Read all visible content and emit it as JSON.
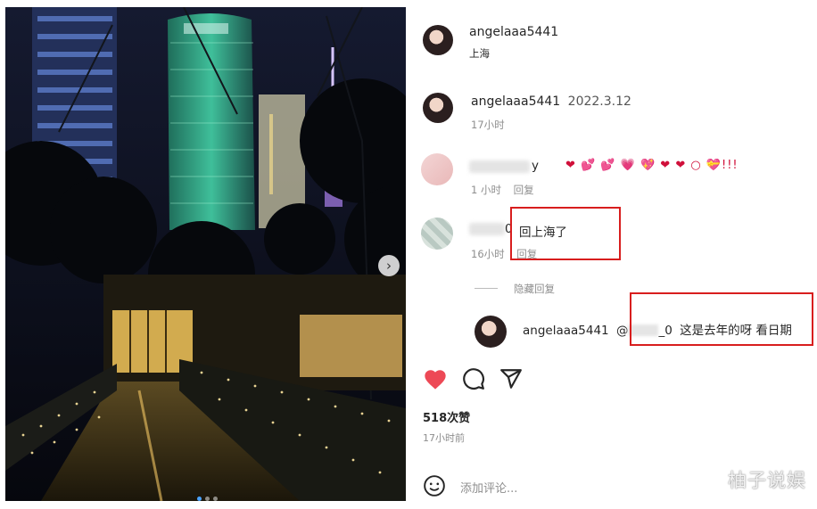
{
  "post_header": {
    "username": "angelaaa5441",
    "location": "上海"
  },
  "caption": {
    "username": "angelaaa5441",
    "date": "2022.3.12",
    "time_ago": "17小时"
  },
  "comment1": {
    "user_partial": "y",
    "emojis": "❤ 💕 💕 💗 💖 ❤ ❤ ○ 💝!!!",
    "time_ago": "1 小时",
    "reply_label": "回复"
  },
  "comment2": {
    "user_partial": "0",
    "text": "回上海了",
    "time_ago": "16小时",
    "reply_label": "回复"
  },
  "hide_replies": "隐藏回复",
  "reply": {
    "username": "angelaaa5441",
    "mention_prefix": "@",
    "mention_suffix": "_0",
    "text": "这是去年的呀 看日期"
  },
  "likes": "518次赞",
  "post_time": "17小时前",
  "add_comment_placeholder": "添加评论...",
  "watermark": "柚子说娱",
  "icons": {
    "like": "heart-icon",
    "comment": "comment-icon",
    "share": "share-icon",
    "next": "chevron-right-icon",
    "emoji": "smiley-icon"
  },
  "colors": {
    "like": "#ed4956",
    "highlight_box": "#d81e1e",
    "carousel_active_dot": "#4aa3ff"
  }
}
